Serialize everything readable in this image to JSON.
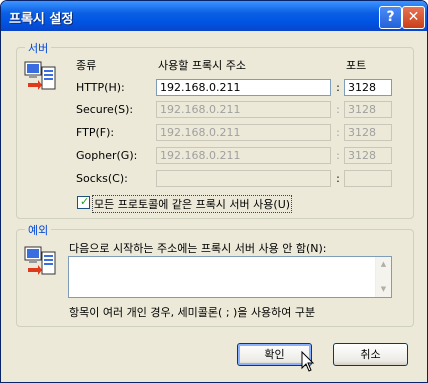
{
  "window": {
    "title": "프록시 설정",
    "help_glyph": "?",
    "close_glyph": "✕"
  },
  "servers": {
    "group_label": "서버",
    "col_type": "종류",
    "col_address": "사용할 프록시 주소",
    "col_port": "포트",
    "colon": ":",
    "rows": [
      {
        "label": "HTTP(H):",
        "address": "192.168.0.211",
        "port": "3128",
        "enabled": true
      },
      {
        "label": "Secure(S):",
        "address": "192.168.0.211",
        "port": "3128",
        "enabled": false
      },
      {
        "label": "FTP(F):",
        "address": "192.168.0.211",
        "port": "3128",
        "enabled": false
      },
      {
        "label": "Gopher(G):",
        "address": "192.168.0.211",
        "port": "3128",
        "enabled": false
      },
      {
        "label": "Socks(C):",
        "address": "",
        "port": "",
        "enabled": false
      }
    ],
    "same_proxy_label": "모든 프로토콜에 같은 프록시 서버 사용(U)",
    "same_proxy_checked": true
  },
  "exceptions": {
    "group_label": "예외",
    "label": "다음으로 시작하는 주소에는 프록시 서버 사용 안 함(N):",
    "value": "",
    "hint": "항목이 여러 개인 경우, 세미콜론( ; )을 사용하여 구분"
  },
  "buttons": {
    "ok": "확인",
    "cancel": "취소"
  },
  "colors": {
    "title_bar": "#0054e3",
    "dialog_bg": "#ece9d8",
    "group_label": "#0046d5"
  }
}
